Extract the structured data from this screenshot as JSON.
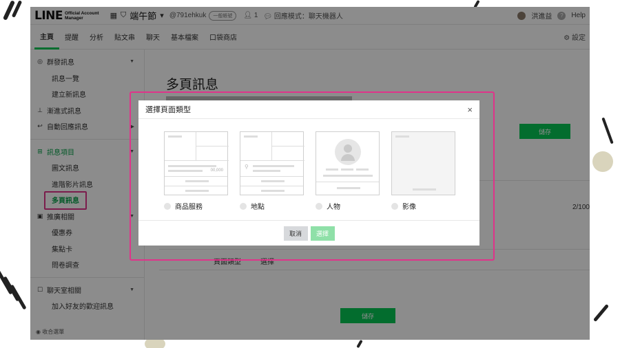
{
  "header": {
    "logo_main": "LINE",
    "logo_sub_1": "Official Account",
    "logo_sub_2": "Manager",
    "account_name": "端午節",
    "account_id": "@791ehkuk",
    "badge": "一般帳號",
    "people_count": "1",
    "mode": "回應模式：聊天機器人",
    "user_name": "洪進益",
    "help": "Help"
  },
  "nav": {
    "tabs": [
      "主頁",
      "提醒",
      "分析",
      "貼文串",
      "聊天",
      "基本檔案",
      "口袋商店"
    ],
    "settings": "設定"
  },
  "sidebar": {
    "items": [
      {
        "label": "群發訊息"
      },
      {
        "label": "訊息一覽"
      },
      {
        "label": "建立新訊息"
      },
      {
        "label": "漸進式訊息"
      },
      {
        "label": "自動回應訊息"
      },
      {
        "label": "訊息項目"
      },
      {
        "label": "圖文訊息"
      },
      {
        "label": "進階影片訊息"
      },
      {
        "label": "多頁訊息"
      },
      {
        "label": "推廣相關"
      },
      {
        "label": "優惠券"
      },
      {
        "label": "集點卡"
      },
      {
        "label": "問卷調查"
      },
      {
        "label": "聊天室相關"
      },
      {
        "label": "加入好友的歡迎訊息"
      }
    ],
    "footer": "收合選單"
  },
  "main": {
    "title": "多頁訊息",
    "save_label": "儲存",
    "count_text": "2/100",
    "page_type_label": "頁面類型",
    "page_type_value": "選擇"
  },
  "modal": {
    "title": "選擇頁面類型",
    "close": "×",
    "options": [
      "商品服務",
      "地點",
      "人物",
      "影像"
    ],
    "price_text": "00,000",
    "cancel_label": "取消",
    "select_label": "選擇"
  }
}
